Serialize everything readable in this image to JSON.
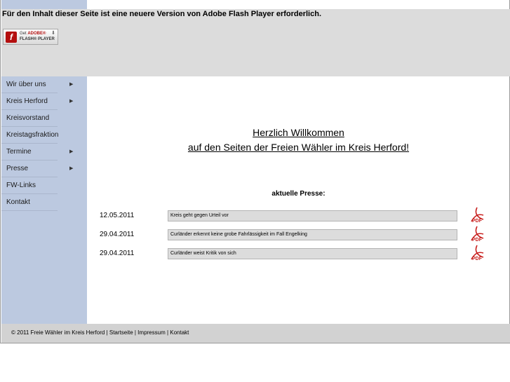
{
  "flash": {
    "message": "Für den Inhalt dieser Seite ist eine neuere Version von Adobe Flash Player erforderlich.",
    "badge_line1_prefix": "Get",
    "badge_line1_brand": "ADOBE®",
    "badge_line2": "FLASH® PLAYER",
    "logo_letter": "f"
  },
  "sidebar": {
    "items": [
      {
        "label": "Wir über uns",
        "has_submenu": true
      },
      {
        "label": "Kreis Herford",
        "has_submenu": true
      },
      {
        "label": "Kreisvorstand",
        "has_submenu": false
      },
      {
        "label": "Kreistagsfraktion",
        "has_submenu": false
      },
      {
        "label": "Termine",
        "has_submenu": true
      },
      {
        "label": "Presse",
        "has_submenu": true
      },
      {
        "label": "FW-Links",
        "has_submenu": false
      },
      {
        "label": "Kontakt",
        "has_submenu": false
      }
    ]
  },
  "main": {
    "welcome_line1": "Herzlich Willkommen",
    "welcome_line2": "auf den Seiten der Freien Wähler im Kreis Herford!",
    "press_heading": "aktuelle Presse:",
    "press": [
      {
        "date": "12.05.2011",
        "title": "Kreis geht gegen Urteil vor"
      },
      {
        "date": "29.04.2011",
        "title": "Curländer erkennt keine grobe Fahrlässigkeit im Fall Engelking"
      },
      {
        "date": "29.04.2011",
        "title": "Curländer weist Kritik von sich"
      }
    ],
    "pdf_label": "PDF"
  },
  "footer": {
    "text": "© 2011 Freie Wähler im Kreis Herford | Startseite | Impressum | Kontakt"
  },
  "colors": {
    "sidebar_bg": "#bcc9e0",
    "flash_bg": "#dcdcdc",
    "footer_bg": "#d2d2d2",
    "pdf_red": "#c8201e"
  }
}
